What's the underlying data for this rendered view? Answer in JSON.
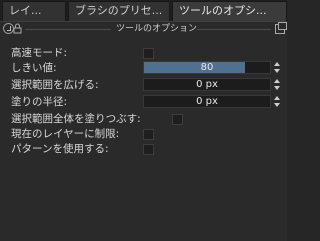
{
  "tabs": [
    {
      "label": "レイ..."
    },
    {
      "label": "ブラシのプリセ..."
    },
    {
      "label": "ツールのオプシ..."
    }
  ],
  "panel": {
    "title": "ツールのオプション",
    "options": {
      "fast_mode": {
        "label": "高速モード:",
        "checked": false
      },
      "threshold": {
        "label": "しきい値:",
        "value": "80",
        "fraction": 0.8
      },
      "grow": {
        "label": "選択範囲を広げる:",
        "value": "0 px"
      },
      "feather": {
        "label": "塗りの半径:",
        "value": "0 px"
      },
      "fill_entire": {
        "label": "選択範囲全体を塗りつぶす:",
        "checked": false
      },
      "limit_layer": {
        "label": "現在のレイヤーに制限:",
        "checked": false
      },
      "use_pattern": {
        "label": "パターンを使用する:",
        "checked": false
      }
    }
  },
  "colors": {
    "accent": "#50708f",
    "panel_bg": "#2a2a2a",
    "tab_bg": "#323232"
  },
  "icons": [
    "toggle-icon",
    "lock-icon",
    "float-docker-icon",
    "chevron-up-icon",
    "chevron-down-icon"
  ]
}
